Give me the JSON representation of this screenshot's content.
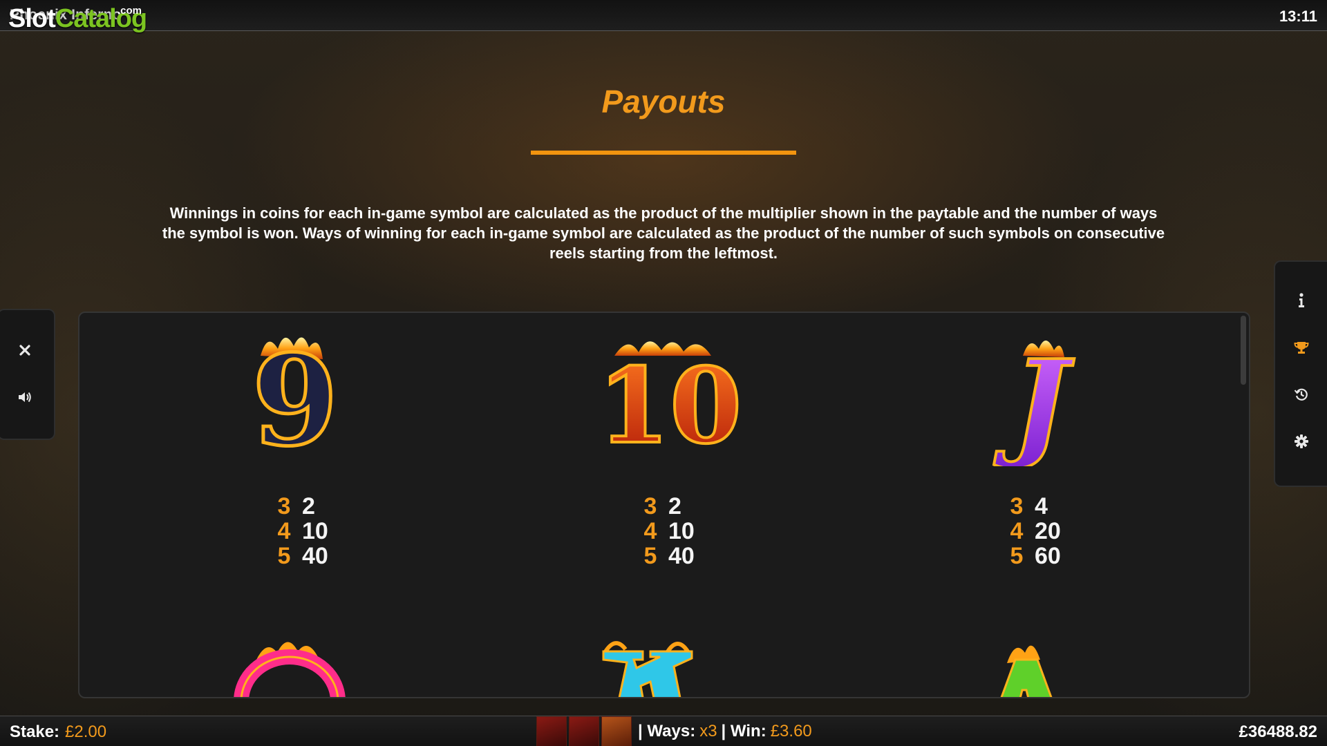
{
  "topbar": {
    "game_title": "Phoenix Inferno",
    "clock": "13:11",
    "watermark": {
      "part1": "Slot",
      "part2": "Catalog",
      "suffix": ".com"
    }
  },
  "payouts": {
    "title": "Payouts",
    "description": "Winnings in coins for each in-game symbol are calculated as the product of the multiplier shown in the paytable and the number of ways the symbol is won. Ways of winning for each in-game symbol are calculated as the product of the number of such symbols on consecutive reels starting from the leftmost.",
    "symbols": [
      {
        "name": "9",
        "pays": [
          {
            "count": "3",
            "amount": "2"
          },
          {
            "count": "4",
            "amount": "10"
          },
          {
            "count": "5",
            "amount": "40"
          }
        ]
      },
      {
        "name": "10",
        "pays": [
          {
            "count": "3",
            "amount": "2"
          },
          {
            "count": "4",
            "amount": "10"
          },
          {
            "count": "5",
            "amount": "40"
          }
        ]
      },
      {
        "name": "J",
        "pays": [
          {
            "count": "3",
            "amount": "4"
          },
          {
            "count": "4",
            "amount": "20"
          },
          {
            "count": "5",
            "amount": "60"
          }
        ]
      },
      {
        "name": "Q"
      },
      {
        "name": "K"
      },
      {
        "name": "A"
      }
    ]
  },
  "side_controls": {
    "left": [
      "close-icon",
      "sound-icon"
    ],
    "right": [
      "info-icon",
      "trophy-icon",
      "history-icon",
      "settings-icon"
    ]
  },
  "bottombar": {
    "stake_label": "Stake:",
    "stake_value": "£2.00",
    "ways_label": "| Ways:",
    "ways_value": "x3",
    "win_label": "| Win:",
    "win_value": "£3.60",
    "balance": "£36488.82"
  },
  "colors": {
    "accent": "#f29a1c",
    "watermark_green": "#7cc421"
  }
}
